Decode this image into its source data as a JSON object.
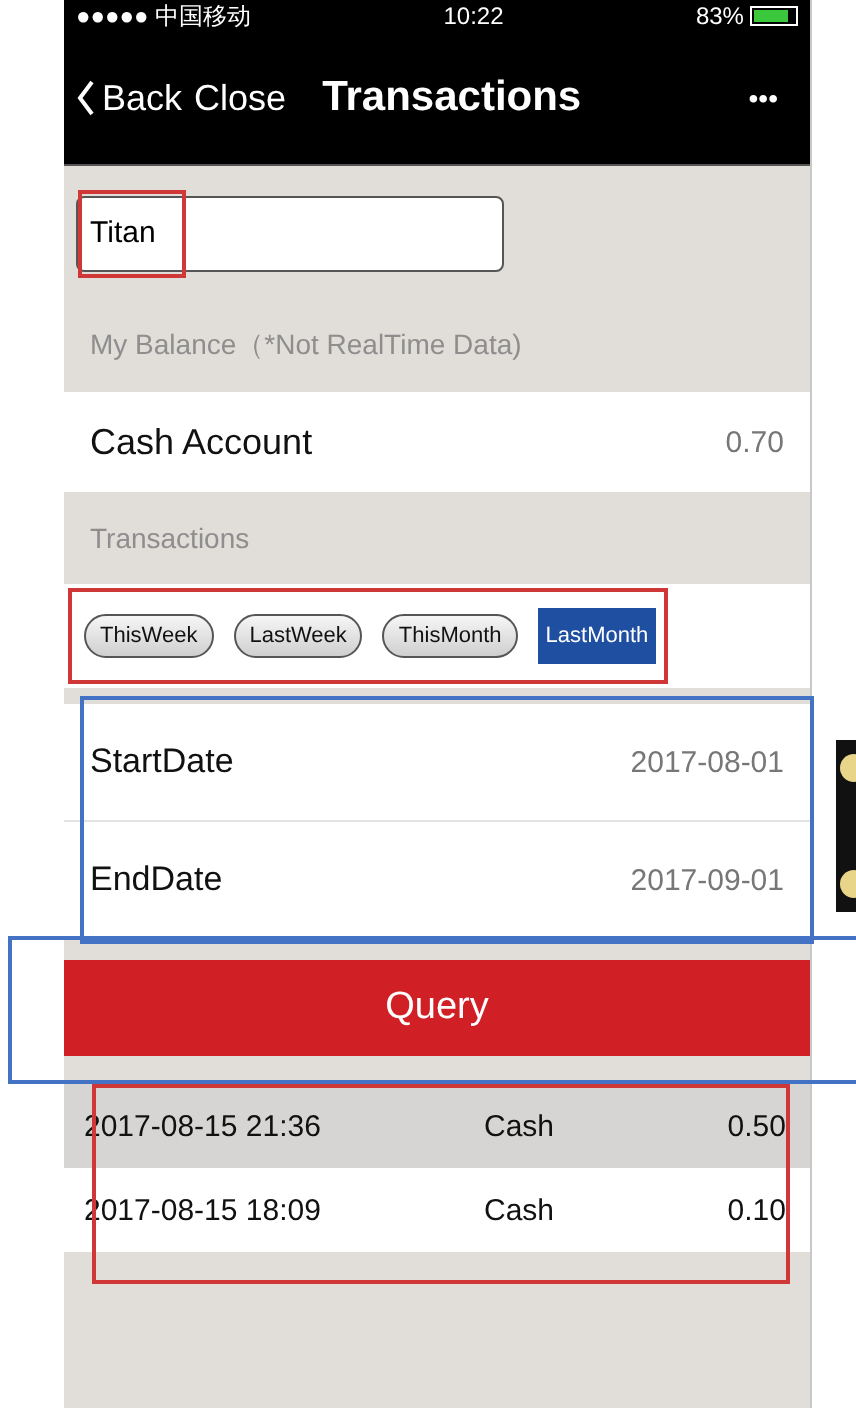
{
  "status_bar": {
    "carrier": "●●●●● 中国移动",
    "time": "10:22",
    "battery": "83%"
  },
  "nav": {
    "back": "Back",
    "close": "Close",
    "title": "Transactions",
    "more": "•••"
  },
  "search": {
    "value": "Titan",
    "color": "#d03838"
  },
  "balance": {
    "header": "My Balance（*Not RealTime Data)",
    "account": "Cash Account",
    "amount": "0.70"
  },
  "transactions": {
    "header": "Transactions",
    "color": "#d03838",
    "tabs": [
      {
        "label": "ThisWeek",
        "selected": false
      },
      {
        "label": "LastWeek",
        "selected": false
      },
      {
        "label": "ThisMonth",
        "selected": false
      },
      {
        "label": "LastMonth",
        "selected": true
      }
    ]
  },
  "dates": {
    "color": "#4472c4",
    "rows": [
      {
        "label": "StartDate",
        "value": "2017-08-01"
      },
      {
        "label": "EndDate",
        "value": "2017-09-01"
      }
    ]
  },
  "query": {
    "label": "Query",
    "color": "#4472c4"
  },
  "results": {
    "color": "#d03838",
    "rows": [
      {
        "time": "2017-08-15 21:36",
        "type": "Cash",
        "amount": "0.50"
      },
      {
        "time": "2017-08-15 18:09",
        "type": "Cash",
        "amount": "0.10"
      }
    ]
  }
}
